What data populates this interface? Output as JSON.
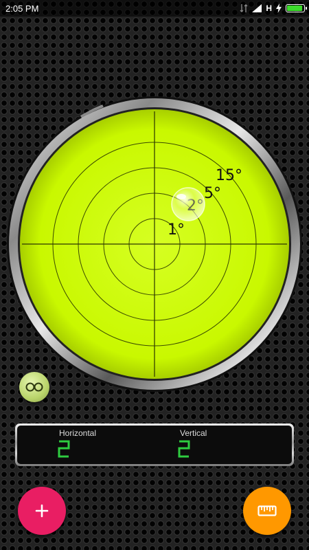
{
  "status_bar": {
    "time": "2:05 PM",
    "network_type": "H",
    "battery_level": 0.9
  },
  "level": {
    "ring_labels": [
      "1°",
      "2°",
      "5°",
      "15°"
    ],
    "bubble_offset_deg": {
      "horizontal": 2,
      "vertical": 2
    },
    "colors": {
      "vial": "#ccff00",
      "lines": "#3a4a00"
    }
  },
  "readout": {
    "horizontal_label": "Horizontal",
    "horizontal_value": "2",
    "vertical_label": "Vertical",
    "vertical_value": "2",
    "digit_color": "#2ecc40"
  },
  "buttons": {
    "view_toggle_icon": "glasses-icon",
    "add_icon": "plus-icon",
    "calibrate_icon": "ruler-icon",
    "add_color": "#e91e63",
    "calibrate_color": "#ff9800"
  }
}
